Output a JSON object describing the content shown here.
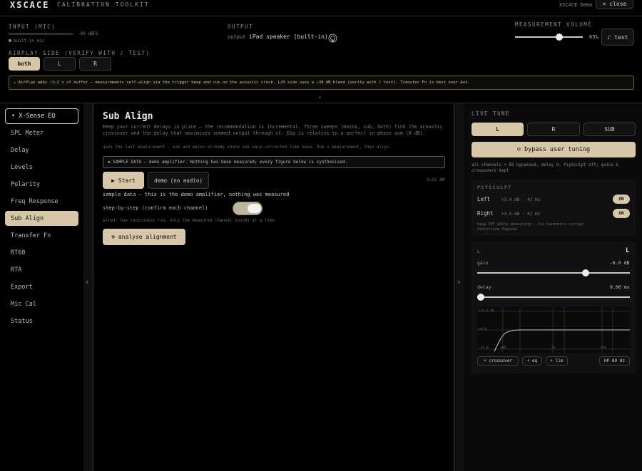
{
  "header": {
    "brand": "XSCACE",
    "subtitle": "CALIBRATION TOOLKIT",
    "demo_label": "XSCACE Demo",
    "close_label": "× close"
  },
  "input": {
    "label": "INPUT (MIC)",
    "level_text": "-60 dBFS",
    "level_fraction": 0.0,
    "device": "built-in mic"
  },
  "output": {
    "label": "OUTPUT",
    "prefix": "output",
    "device": "iPad speaker (built-in)"
  },
  "volume": {
    "label": "MEASUREMENT VOLUME",
    "percent_text": "65%",
    "value": 0.65,
    "test_label": "♪ test"
  },
  "airplay": {
    "label": "AIRPLAY SIDE (VERIFY WITH ♪ TEST)",
    "options": [
      "both",
      "L",
      "R"
    ],
    "selected": "both",
    "notice": "⚠ AirPlay adds ~1–2 s of buffer — measurements self-align via the trigger beep and run on the acoustic clock. L/R side uses a −38 dB bleed (verify with ♪ test). Transfer Fn is best over Aux."
  },
  "sidebar": {
    "items": [
      {
        "label": "• X-Sense EQ"
      },
      {
        "label": "SPL Meter"
      },
      {
        "label": "Delay"
      },
      {
        "label": "Levels"
      },
      {
        "label": "Polarity"
      },
      {
        "label": "Freq Response"
      },
      {
        "label": "Sub Align"
      },
      {
        "label": "Transfer Fn"
      },
      {
        "label": "RT60"
      },
      {
        "label": "RTA"
      },
      {
        "label": "Export"
      },
      {
        "label": "Mic Cal"
      },
      {
        "label": "Status"
      }
    ],
    "active": "Sub Align"
  },
  "main": {
    "title": "Sub Align",
    "description": "Keep your current delays in place — the recommendation is incremental. Three sweeps (mains, sub, both) find the acoustic crossover and the delay that maximises summed output through it. Dip is relative to a perfect in-phase sum (0 dB).",
    "note": "uses the last measurement — sub and mains already share one warp-corrected time base. Run a measurement, then align.",
    "sample_banner": "◈ SAMPLE DATA — demo amplifier. Nothing has been measured; every figure below is synthesised.",
    "start_label": "▶ Start",
    "demo_label": "demo (no audio)",
    "time": "3:52 AM",
    "sample_note": "sample data — this is the demo amplifier, nothing was measured",
    "step_label": "step-by-step (confirm each channel)",
    "step_on": true,
    "wired_note": "wired: one continuous run, only the measured channel sounds at a time",
    "analyse_label": "⊕ analyse alignment"
  },
  "live": {
    "label": "LIVE TUNE",
    "tabs": [
      "L",
      "R",
      "SUB"
    ],
    "selected_tab": "L",
    "bypass_label": "⊘ bypass user tuning",
    "bypass_note": "all channels + EQ bypassed, delay 0. PsySculpt off; gains & crossovers kept",
    "psysculpt": {
      "label": "PSYSCULPT",
      "rows": [
        {
          "name": "Left",
          "value": "+3.0 dB · 42 Hz",
          "state": "ON"
        },
        {
          "name": "Right",
          "value": "+3.0 dB · 42 Hz",
          "state": "ON"
        }
      ],
      "note": "keep OFF while measuring — its harmonics corrupt distortion figures"
    },
    "channel": {
      "label": "L",
      "badge": "L",
      "gain_label": "gain",
      "gain_value": "-6.0 dB",
      "gain_fraction": 0.71,
      "delay_label": "delay",
      "delay_value": "0.00 ms",
      "delay_fraction": 0.0
    },
    "graph": {
      "y_labels": [
        "+24.0 dB",
        "+0.0",
        "-24.0"
      ],
      "x_labels": [
        "100",
        "1k",
        "10k"
      ]
    },
    "buttons": {
      "crossover": "+ crossover",
      "eq": "+ eq",
      "lim": "+ lim",
      "hp": "HP 80 Hz"
    }
  },
  "colors": {
    "accent": "#d6c8a6",
    "background": "#000000",
    "panel": "#111111"
  }
}
